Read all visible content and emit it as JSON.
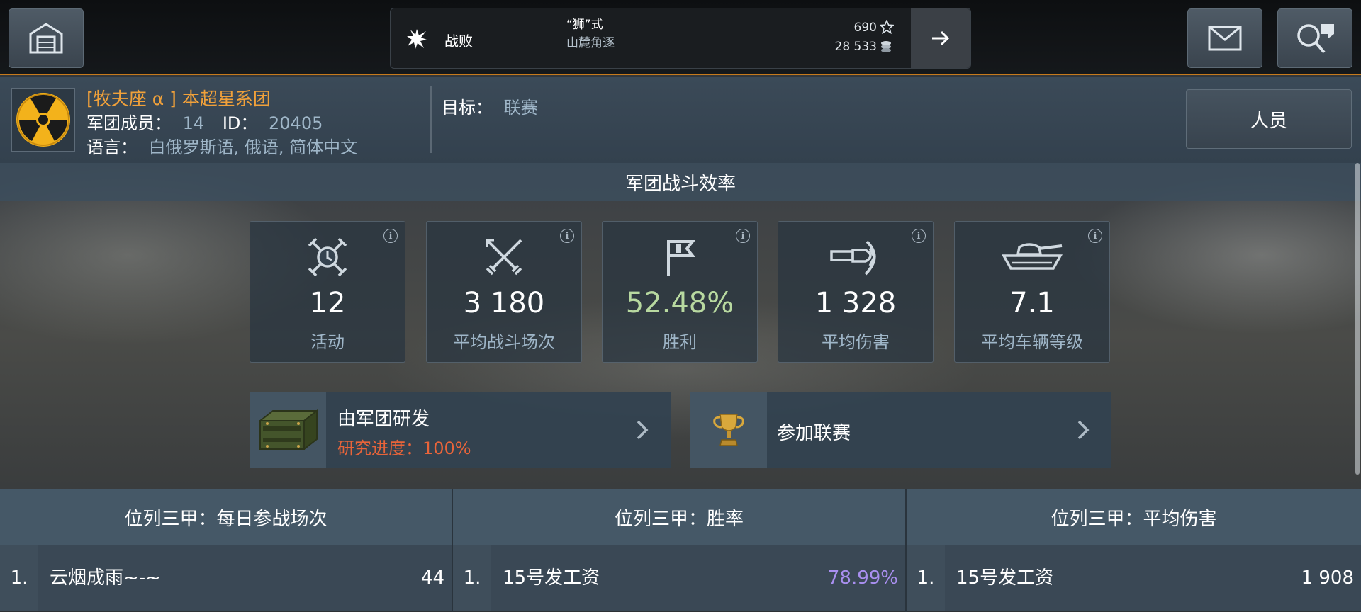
{
  "topbar": {
    "home_icon": "garage-icon",
    "mail_icon": "mail-icon",
    "search_icon": "search-clan-icon",
    "last_battle": {
      "result": "战败",
      "vehicle": "“狮”式",
      "map": "山麓角逐",
      "experience": "690",
      "credits": "28 533",
      "result_icon": "explosion-icon",
      "xp_icon": "star-icon",
      "credits_icon": "coins-icon",
      "arrow_icon": "arrow-right-icon"
    }
  },
  "clan": {
    "name": "[牧夫座 α ] 本超星系团",
    "members_label": "军团成员：",
    "members_value": "14",
    "id_label": "ID：",
    "id_value": "20405",
    "language_label": "语言：",
    "language_value": "白俄罗斯语, 俄语, 简体中文",
    "goal_label": "目标：",
    "goal_value": "联赛",
    "personnel_button": "人员",
    "emblem_icon": "radiation-emblem-icon"
  },
  "efficiency": {
    "title": "军团战斗效率",
    "stats": [
      {
        "value": "12",
        "label": "活动",
        "icon": "activity-icon",
        "color": "#ffffff"
      },
      {
        "value": "3 180",
        "label": "平均战斗场次",
        "icon": "crossed-swords-icon",
        "color": "#ffffff"
      },
      {
        "value": "52.48%",
        "label": "胜利",
        "icon": "flag-icon",
        "color": "#b8d9a0"
      },
      {
        "value": "1 328",
        "label": "平均伤害",
        "icon": "shell-icon",
        "color": "#ffffff"
      },
      {
        "value": "7.1",
        "label": "平均车辆等级",
        "icon": "tank-icon",
        "color": "#ffffff"
      }
    ]
  },
  "actions": {
    "research": {
      "title": "由军团研发",
      "subtitle": "研究进度：100%",
      "icon": "supply-crate-icon"
    },
    "league": {
      "title": "参加联赛",
      "icon": "trophy-icon"
    }
  },
  "leaderboards": [
    {
      "title": "位列三甲：每日参战场次",
      "rank": "1.",
      "player": "云烟成雨~-~",
      "value": "44",
      "value_color": "#ffffff"
    },
    {
      "title": "位列三甲：胜率",
      "rank": "1.",
      "player": "15号发工资",
      "value": "78.99%",
      "value_color": "#a98ff0"
    },
    {
      "title": "位列三甲：平均伤害",
      "rank": "1.",
      "player": "15号发工资",
      "value": "1 908",
      "value_color": "#ffffff"
    }
  ],
  "colors": {
    "accent": "#f1a13a",
    "win_rate": "#b8d9a0",
    "research_progress": "#e8643a",
    "top_win_rate": "#a98ff0"
  }
}
